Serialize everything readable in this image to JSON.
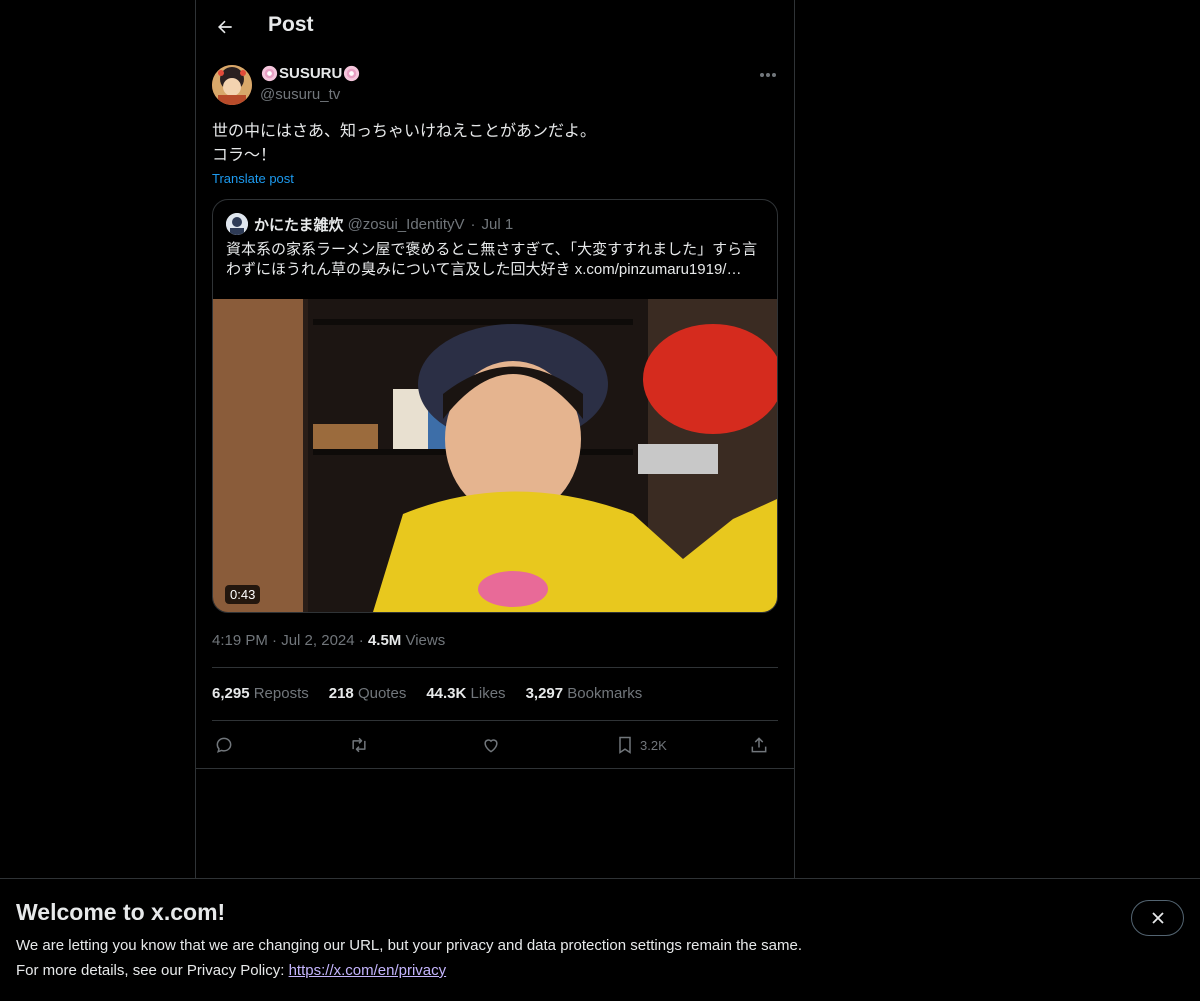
{
  "header": {
    "title": "Post"
  },
  "post": {
    "name": "SUSURU",
    "handle": "@susuru_tv",
    "text": "世の中にはさあ、知っちゃいけねえことがあンだよ。\nコラ〜！",
    "translate_label": "Translate post",
    "time": "4:19 PM",
    "date": "Jul 2, 2024",
    "views_count": "4.5M",
    "views_label": "Views"
  },
  "quote": {
    "name": "かにたま雑炊",
    "handle": "@zosui_IdentityV",
    "date": "Jul 1",
    "text": "資本系の家系ラーメン屋で褒めるとこ無さすぎて、「大変すすれました」すら言わずにほうれん草の臭みについて言及した回大好き x.com/pinzumaru1919/…",
    "video_duration": "0:43"
  },
  "stats": {
    "reposts_count": "6,295",
    "reposts_label": "Reposts",
    "quotes_count": "218",
    "quotes_label": "Quotes",
    "likes_count": "44.3K",
    "likes_label": "Likes",
    "bookmarks_count": "3,297",
    "bookmarks_label": "Bookmarks"
  },
  "actions": {
    "bookmark_count": "3.2K"
  },
  "icons": {
    "back": "back-arrow-icon",
    "more": "more-dots-icon",
    "reply": "reply-icon",
    "repost": "repost-icon",
    "like": "heart-icon",
    "bookmark": "bookmark-icon",
    "share": "share-icon",
    "close": "close-icon",
    "name_decoration": "flower-icon"
  },
  "banner": {
    "title": "Welcome to x.com!",
    "line1": "We are letting you know that we are changing our URL, but your privacy and data protection settings remain the same.",
    "line2_prefix": "For more details, see our Privacy Policy: ",
    "line2_link": "https://x.com/en/privacy"
  },
  "colors": {
    "background": "#000000",
    "text": "#e7e9ea",
    "muted": "#71767b",
    "accent": "#1d9bf0",
    "border": "#2f3336"
  }
}
